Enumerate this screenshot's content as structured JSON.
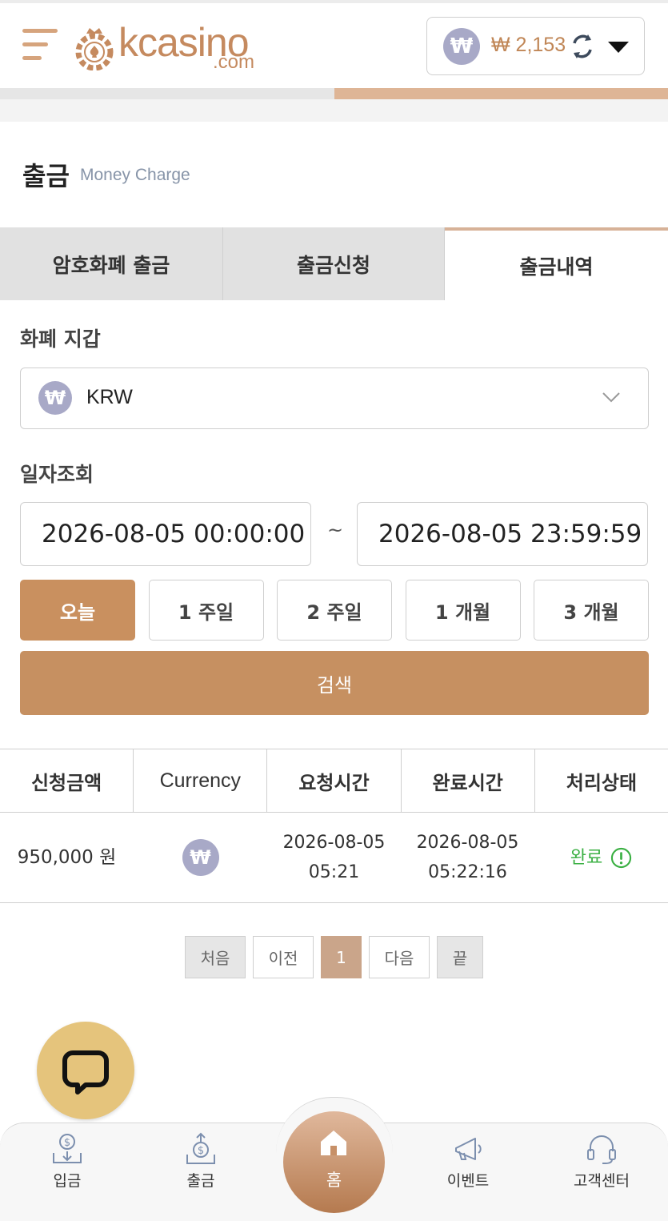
{
  "header": {
    "logo_text": "kcasino",
    "logo_sub": ".com",
    "currency_symbol": "₩",
    "balance": "₩ 2,153"
  },
  "page": {
    "title": "출금",
    "subtitle": "Money Charge"
  },
  "tabs": [
    {
      "label": "암호화폐 출금",
      "active": false
    },
    {
      "label": "출금신청",
      "active": false
    },
    {
      "label": "출금내역",
      "active": true
    }
  ],
  "wallet": {
    "label": "화폐 지갑",
    "selected": "KRW",
    "symbol": "₩"
  },
  "date_filter": {
    "label": "일자조회",
    "start": "2026-08-05 00:00:00",
    "separator": "~",
    "end": "2026-08-05 23:59:59",
    "periods": [
      "오늘",
      "1 주일",
      "2 주일",
      "1 개월",
      "3 개월"
    ],
    "active_period": "오늘",
    "search_label": "검색"
  },
  "table": {
    "headers": [
      "신청금액",
      "Currency",
      "요청시간",
      "완료시간",
      "처리상태"
    ],
    "rows": [
      {
        "amount": "950,000 원",
        "currency_symbol": "₩",
        "request_date": "2026-08-05",
        "request_time": "05:21",
        "complete_date": "2026-08-05",
        "complete_time": "05:22:16",
        "status": "완료"
      }
    ]
  },
  "pagination": {
    "first": "처음",
    "prev": "이전",
    "current": "1",
    "next": "다음",
    "last": "끝"
  },
  "bottom_nav": {
    "deposit": "입금",
    "withdraw": "출금",
    "home": "홈",
    "event": "이벤트",
    "support": "고객센터"
  },
  "colors": {
    "accent": "#c69061",
    "status_ok": "#3bb043",
    "currency_badge": "#a8a9c7"
  }
}
